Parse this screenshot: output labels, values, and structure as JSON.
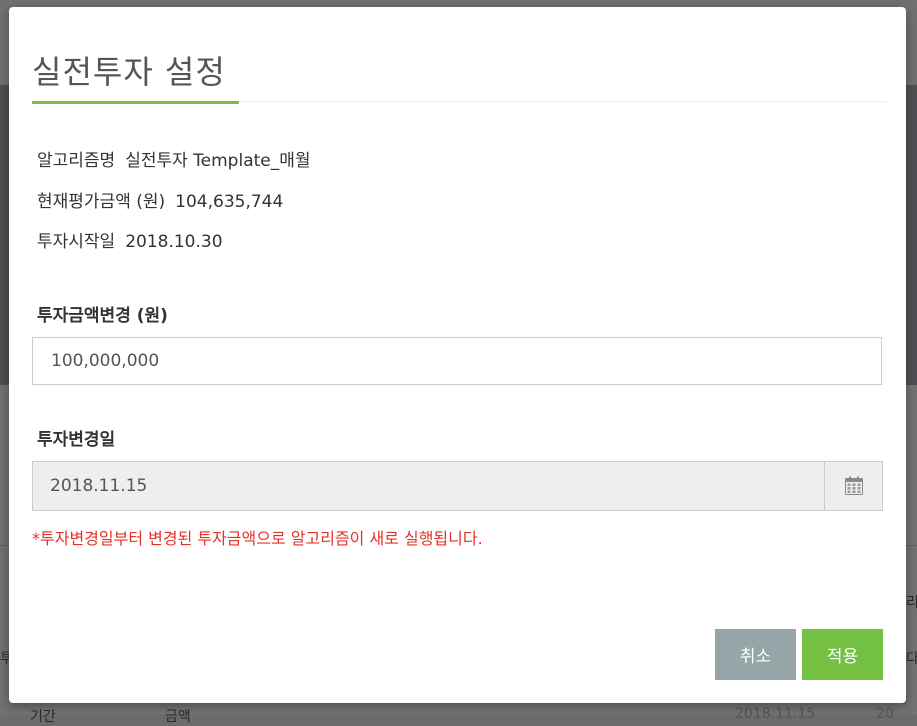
{
  "background": {
    "fragments": [
      "투",
      "리",
      "다",
      "기간",
      "금액",
      "2018.11.15",
      "20"
    ]
  },
  "modal": {
    "title": "실전투자 설정",
    "info": [
      {
        "label": "알고리즘명",
        "value": "실전투자 Template_매월"
      },
      {
        "label": "현재평가금액 (원)",
        "value": "104,635,744"
      },
      {
        "label": "투자시작일",
        "value": "2018.10.30"
      }
    ],
    "amount_label": "투자금액변경 (원)",
    "amount_value": "100,000,000",
    "date_label": "투자변경일",
    "date_value": "2018.11.15",
    "calendar_icon": "calendar-icon",
    "note": "*투자변경일부터 변경된 투자금액으로 알고리즘이 새로 실행됩니다.",
    "cancel_label": "취소",
    "apply_label": "적용"
  },
  "colors": {
    "accent_green": "#74c043",
    "cancel_gray": "#96a5a7",
    "note_red": "#e8302a"
  }
}
